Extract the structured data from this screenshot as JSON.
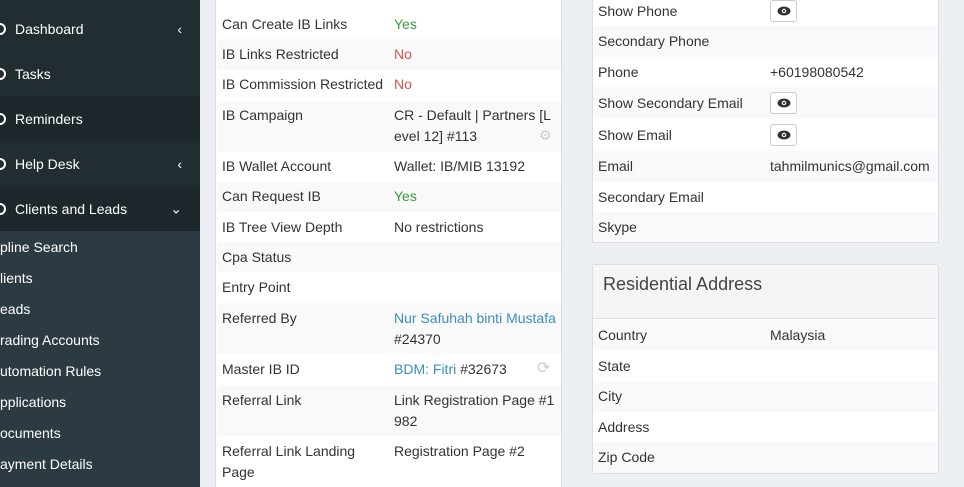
{
  "sidebar": {
    "menu": [
      {
        "label": "Dashboard",
        "chevron": "‹"
      },
      {
        "label": "Tasks",
        "chevron": ""
      },
      {
        "label": "Reminders",
        "chevron": ""
      },
      {
        "label": "Help Desk",
        "chevron": "‹"
      },
      {
        "label": "Clients and Leads",
        "chevron": "⌄"
      }
    ],
    "submenu": [
      "pline Search",
      "lients",
      "eads",
      "rading Accounts",
      "utomation Rules",
      "pplications",
      "ocuments",
      "ayment Details"
    ]
  },
  "left_table": {
    "rows": [
      {
        "key": "Can Create IB Links",
        "value": "Yes"
      },
      {
        "key": "IB Links Restricted",
        "value": "No"
      },
      {
        "key": "IB Commission Restricted",
        "value": "No"
      },
      {
        "key": "IB Campaign",
        "value": "CR - Default | Partners [Level 12] #113"
      },
      {
        "key": "IB Wallet Account",
        "value": "Wallet: IB/MIB 13192"
      },
      {
        "key": "Can Request IB",
        "value": "Yes"
      },
      {
        "key": "IB Tree View Depth",
        "value": "No restrictions"
      },
      {
        "key": "Cpa Status",
        "value": ""
      },
      {
        "key": "Entry Point",
        "value": ""
      },
      {
        "key": "Referred By",
        "value_link": "Nur Safuhah binti Mustafa",
        "value": "#24370"
      },
      {
        "key": "Master IB ID",
        "value_link": "BDM: Fitri",
        "value": " #32673"
      },
      {
        "key": "Referral Link",
        "value": "Link Registration Page #1982"
      },
      {
        "key": "Referral Link Landing Page",
        "value": "Registration Page #2"
      }
    ]
  },
  "contact": {
    "rows": [
      {
        "key": "Show Phone",
        "value": ""
      },
      {
        "key": "Secondary Phone",
        "value": ""
      },
      {
        "key": "Phone",
        "value": "+60198080542"
      },
      {
        "key": "Show Secondary Email",
        "value": ""
      },
      {
        "key": "Show Email",
        "value": ""
      },
      {
        "key": "Email",
        "value": "tahmilmunics@gmail.com"
      },
      {
        "key": "Secondary Email",
        "value": ""
      },
      {
        "key": "Skype",
        "value": ""
      }
    ]
  },
  "address": {
    "title": "Residential Address",
    "rows": [
      {
        "key": "Country",
        "value": "Malaysia"
      },
      {
        "key": "State",
        "value": ""
      },
      {
        "key": "City",
        "value": ""
      },
      {
        "key": "Address",
        "value": ""
      },
      {
        "key": "Zip Code",
        "value": ""
      }
    ]
  },
  "colors": {
    "sidebar": "#222d32",
    "link": "#3c8dbc",
    "yes": "#3c9a3c",
    "no": "#d9534f"
  }
}
